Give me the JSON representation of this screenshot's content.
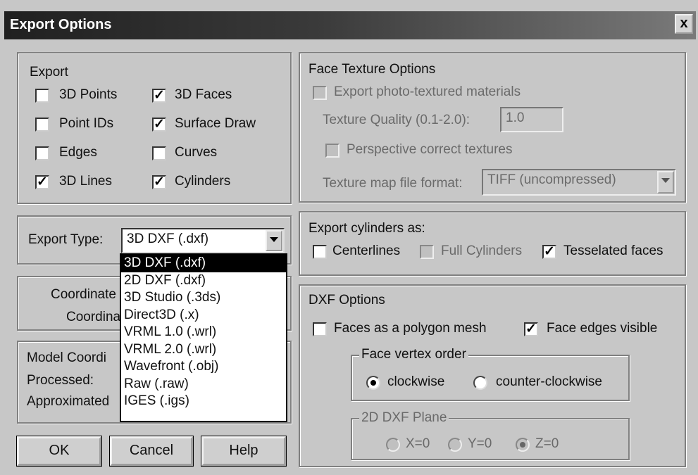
{
  "window": {
    "title": "Export Options",
    "close_glyph": "x"
  },
  "export_group": {
    "label": "Export",
    "checkboxes": [
      {
        "label": "3D Points",
        "checked": false
      },
      {
        "label": "Point IDs",
        "checked": false
      },
      {
        "label": "Edges",
        "checked": false
      },
      {
        "label": "3D Lines",
        "checked": true
      },
      {
        "label": "3D Faces",
        "checked": true
      },
      {
        "label": "Surface Draw",
        "checked": true
      },
      {
        "label": "Curves",
        "checked": false
      },
      {
        "label": "Cylinders",
        "checked": true
      }
    ]
  },
  "export_type": {
    "label": "Export Type:",
    "value": "3D DXF (.dxf)",
    "options": [
      "3D DXF (.dxf)",
      "2D DXF (.dxf)",
      "3D Studio (.3ds)",
      "Direct3D (.x)",
      "VRML 1.0 (.wrl)",
      "VRML 2.0 (.wrl)",
      "Wavefront (.obj)",
      "Raw (.raw)",
      "IGES (.igs)"
    ]
  },
  "coordinate_group": {
    "line1": "Coordinate",
    "line2": "Coordina"
  },
  "model_coord_group": {
    "title": "Model Coordi",
    "processed": "Processed:",
    "approximated": "Approximated"
  },
  "buttons": {
    "ok": "OK",
    "cancel": "Cancel",
    "help": "Help"
  },
  "face_texture": {
    "title": "Face Texture Options",
    "export_photo": "Export photo-textured materials",
    "quality_label": "Texture Quality (0.1-2.0):",
    "quality_value": "1.0",
    "perspective": "Perspective correct textures",
    "map_format_label": "Texture map file format:",
    "map_format_value": "TIFF (uncompressed)"
  },
  "cylinders": {
    "title": "Export cylinders as:",
    "centerlines": {
      "label": "Centerlines",
      "checked": false
    },
    "full": {
      "label": "Full Cylinders",
      "checked": false
    },
    "tesselated": {
      "label": "Tesselated faces",
      "checked": true
    }
  },
  "dxf": {
    "title": "DXF Options",
    "polygon_mesh": {
      "label": "Faces as a polygon mesh",
      "checked": false
    },
    "edges_visible": {
      "label": "Face edges visible",
      "checked": true
    },
    "vertex_order": {
      "title": "Face vertex order",
      "clockwise": "clockwise",
      "counter": "counter-clockwise",
      "selected": "clockwise"
    },
    "plane": {
      "title": "2D DXF Plane",
      "x": "X=0",
      "y": "Y=0",
      "z": "Z=0",
      "selected": "Z=0"
    }
  }
}
